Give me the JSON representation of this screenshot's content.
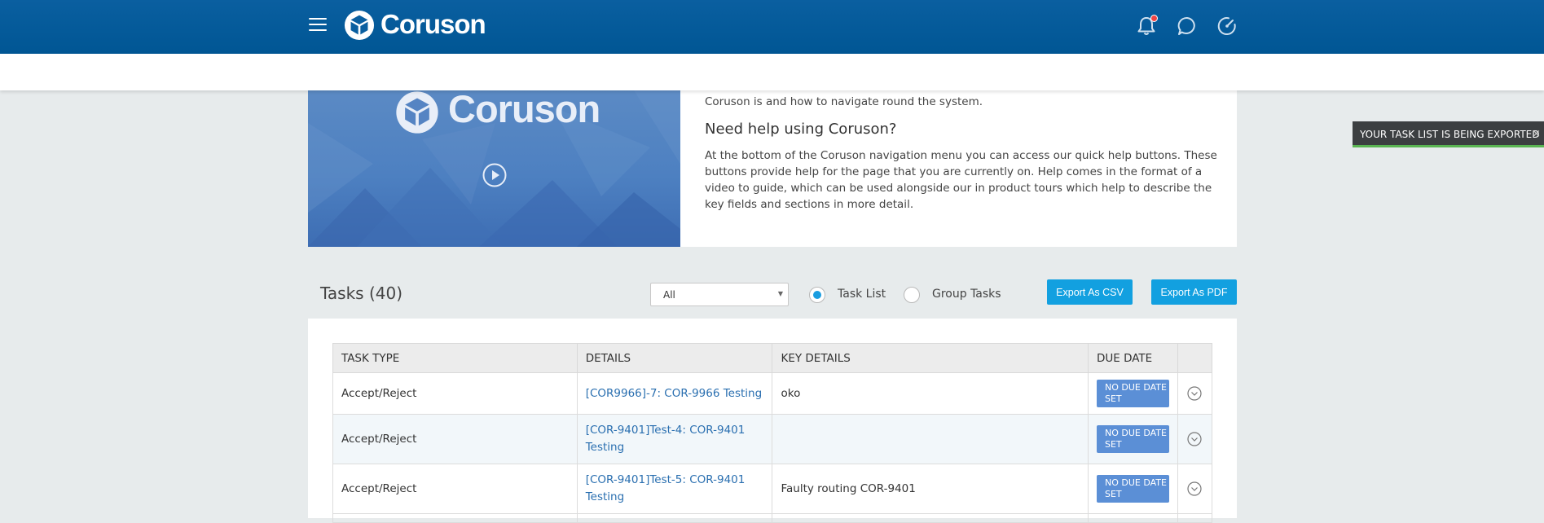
{
  "header": {
    "brand": "Coruson",
    "icons": [
      "menu-icon",
      "bell-icon",
      "chat-icon",
      "dashboard-icon"
    ],
    "accent_color": "#005694"
  },
  "intro": {
    "video_brand": "Coruson",
    "intro_line": "Coruson is and how to navigate round the system.",
    "help_heading": "Need help using Coruson?",
    "help_body": "At the bottom of the Coruson navigation menu you can access our quick help buttons. These buttons provide help for the page that you are currently on. Help comes in the format of a video to guide, which can be used alongside our in product tours which help to describe the key fields and sections in more detail."
  },
  "toast": {
    "message": "YOUR TASK LIST IS BEING EXPORTED",
    "close": "×"
  },
  "tasks": {
    "title": "Tasks (40)",
    "filter_value": "All",
    "radio_task_list": "Task List",
    "radio_group_tasks": "Group Tasks",
    "selected_view": "Task List",
    "export_csv": "Export As CSV",
    "export_pdf": "Export As PDF",
    "columns": [
      "TASK TYPE",
      "DETAILS",
      "KEY DETAILS",
      "DUE DATE"
    ],
    "rows": [
      {
        "type": "Accept/Reject",
        "details": "[COR9966]-7: COR-9966 Testing",
        "key_details": "oko",
        "due": "NO DUE DATE SET"
      },
      {
        "type": "Accept/Reject",
        "details": "[COR-9401]Test-4: COR-9401 Testing",
        "key_details": "",
        "due": "NO DUE DATE SET"
      },
      {
        "type": "Accept/Reject",
        "details": "[COR-9401]Test-5: COR-9401 Testing",
        "key_details": "Faulty routing COR-9401",
        "due": "NO DUE DATE SET"
      }
    ]
  }
}
